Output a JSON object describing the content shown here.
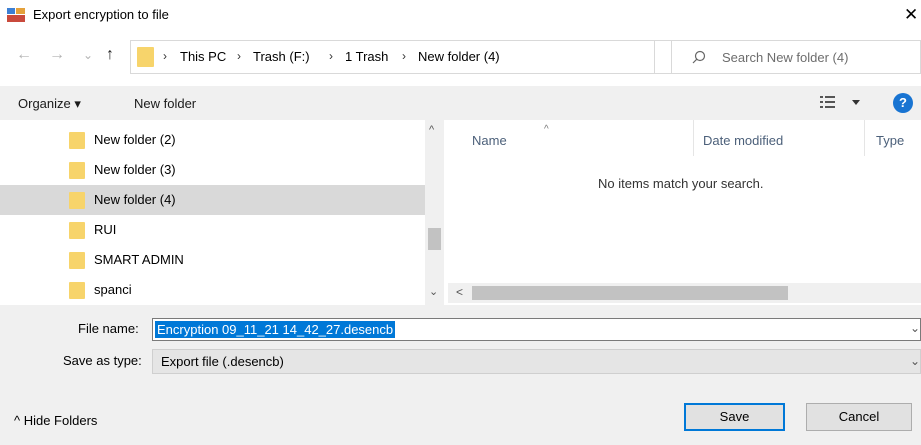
{
  "window": {
    "title": "Export encryption to file",
    "close_glyph": "✕"
  },
  "nav_buttons": {
    "back": "←",
    "forward": "→",
    "recent": "⌄",
    "up": "↑"
  },
  "address": {
    "crumbs": [
      "This PC",
      "Trash (F:)",
      "1 Trash",
      "New folder (4)"
    ],
    "separator": "›",
    "dropdown": "⌄"
  },
  "refresh_glyph": "↻",
  "search": {
    "placeholder": "Search New folder (4)"
  },
  "toolbar": {
    "organize_label": "Organize ▾",
    "new_folder_label": "New folder",
    "help_label": "?"
  },
  "tree": {
    "items": [
      {
        "label": "New folder (2)",
        "selected": false
      },
      {
        "label": "New folder (3)",
        "selected": false
      },
      {
        "label": "New folder (4)",
        "selected": true
      },
      {
        "label": "RUI",
        "selected": false
      },
      {
        "label": "SMART ADMIN",
        "selected": false
      },
      {
        "label": "spanci",
        "selected": false
      }
    ],
    "scroll_up": "^",
    "scroll_down": "⌄"
  },
  "file_list": {
    "columns": [
      "Name",
      "Date modified",
      "Type"
    ],
    "sort_indicator": "^",
    "empty_message": "No items match your search.",
    "scroll_left": "<"
  },
  "form": {
    "file_name_label": "File name:",
    "file_name_value": "Encryption 09_11_21 14_42_27.desencb",
    "save_type_label": "Save as type:",
    "save_type_value": "Export file (.desencb)",
    "dropdown_glyph": "⌄"
  },
  "footer": {
    "hide_folders_label": "^  Hide Folders",
    "save_label": "Save",
    "cancel_label": "Cancel"
  },
  "colors": {
    "accent": "#0078d7",
    "help_blue": "#1874d2",
    "folder": "#f7d46b",
    "selection": "#d9d9d9"
  }
}
